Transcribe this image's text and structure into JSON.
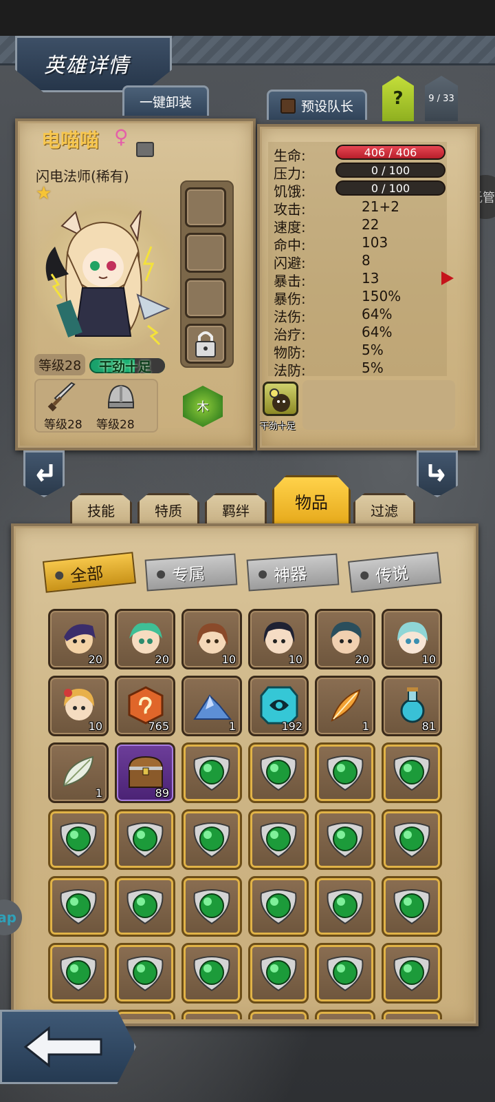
{
  "header": {
    "title": "英雄详情"
  },
  "top_buttons": {
    "unequip_all": "一键卸装",
    "preset_captain": "预设队长",
    "help": "?",
    "hero_index": "9 / 33"
  },
  "side_buttons": {
    "auto": "托管",
    "app": "ap"
  },
  "hero": {
    "name": "电喵喵",
    "gender_symbol": "♀",
    "class": "闪电法师(稀有)",
    "stars": "★",
    "level": "等级28",
    "status": "干劲十足",
    "weapon_level": "等级28",
    "armor_level": "等级28",
    "element": "木"
  },
  "stats": {
    "hp": {
      "label": "生命:",
      "value": "406 / 406",
      "fraction": 1.0
    },
    "stress": {
      "label": "压力:",
      "value": "0 / 100",
      "fraction": 0
    },
    "hunger": {
      "label": "饥饿:",
      "value": "0 / 100",
      "fraction": 0
    },
    "rows": [
      {
        "label": "攻击:",
        "value": "21+2"
      },
      {
        "label": "速度:",
        "value": "22"
      },
      {
        "label": "命中:",
        "value": "103"
      },
      {
        "label": "闪避:",
        "value": "8"
      },
      {
        "label": "暴击:",
        "value": "13"
      },
      {
        "label": "暴伤:",
        "value": "150%"
      },
      {
        "label": "法伤:",
        "value": "64%"
      },
      {
        "label": "治疗:",
        "value": "64%"
      },
      {
        "label": "物防:",
        "value": "5%"
      },
      {
        "label": "法防:",
        "value": "5%"
      }
    ],
    "buff_label": "干劲十足"
  },
  "category_tabs": [
    "技能",
    "特质",
    "羁绊",
    "物品",
    "过滤"
  ],
  "active_tab": "物品",
  "filters": [
    "全部",
    "专属",
    "神器",
    "传说"
  ],
  "active_filter": "全部",
  "inventory": {
    "row1": [
      "20",
      "20",
      "10",
      "10",
      "20",
      "10"
    ],
    "row2": [
      "10",
      "765",
      "1",
      "192",
      "1",
      "81"
    ],
    "row3": [
      "1",
      "89"
    ]
  },
  "colors": {
    "parchment": "#cdb585",
    "hp_bar": "#d22f3c",
    "active_tab": "#f2b92e",
    "frame_blue": "#31445a"
  }
}
